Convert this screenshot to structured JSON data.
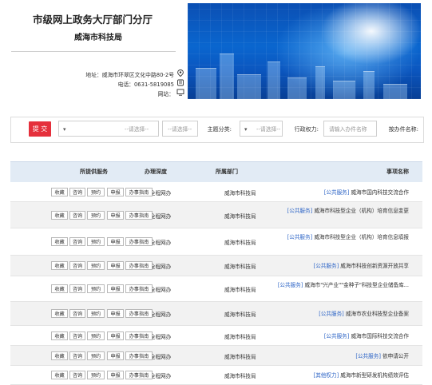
{
  "header": {
    "title": "市级网上政务大厅部门分厅",
    "subtitle": "威海市科技局",
    "address": "地址：威海市环翠区文化中路80-2号",
    "phone": "电话：0631-5819085",
    "website": "网站："
  },
  "filter": {
    "item_name_label": "按办件名称:",
    "item_name_placeholder": "请输入办件名称",
    "power_label": "行政权力:",
    "power_value": "--请选择--",
    "theme_label": "主题分类:",
    "theme_value": "--请选择--",
    "dept_value": "--请选择--",
    "submit_label": "提 交"
  },
  "table": {
    "headers": [
      "事项名称",
      "所属部门",
      "办理深度",
      "所提供服务"
    ],
    "buttons": [
      "办事指南",
      "申报",
      "预约",
      "咨询",
      "收藏"
    ],
    "rows": [
      {
        "name": "威海市国内科技交流合作",
        "tag": "[公共服务]",
        "dept": "威海市科技局",
        "depth": "全程网办"
      },
      {
        "name": "威海市科技型企业（机构）培育信息变更",
        "tag": "[公共服务]",
        "dept": "威海市科技局",
        "depth": "全程网办"
      },
      {
        "name": "威海市科技型企业（机构）培育信息填报",
        "tag": "[公共服务]",
        "dept": "威海市科技局",
        "depth": "全程网办"
      },
      {
        "name": "威海市科技创新资源开放共享",
        "tag": "[公共服务]",
        "dept": "威海市科技局",
        "depth": "全程网办"
      },
      {
        "name": "威海市\"兴产业\"\"金种子\"科技型企业储备库...",
        "tag": "[公共服务]",
        "dept": "威海市科技局",
        "depth": "全程网办"
      },
      {
        "name": "威海市农业科技型企业备案",
        "tag": "[公共服务]",
        "dept": "威海市科技局",
        "depth": "全程网办"
      },
      {
        "name": "威海市国际科技交流合作",
        "tag": "[公共服务]",
        "dept": "威海市科技局",
        "depth": "全程网办"
      },
      {
        "name": "依申请公开",
        "tag": "[公共服务]",
        "dept": "威海市科技局",
        "depth": "全程网办"
      },
      {
        "name": "威海市新型研发机构绩效评估",
        "tag": "[其他权力]",
        "dept": "威海市科技局",
        "depth": "全程网办"
      }
    ]
  }
}
